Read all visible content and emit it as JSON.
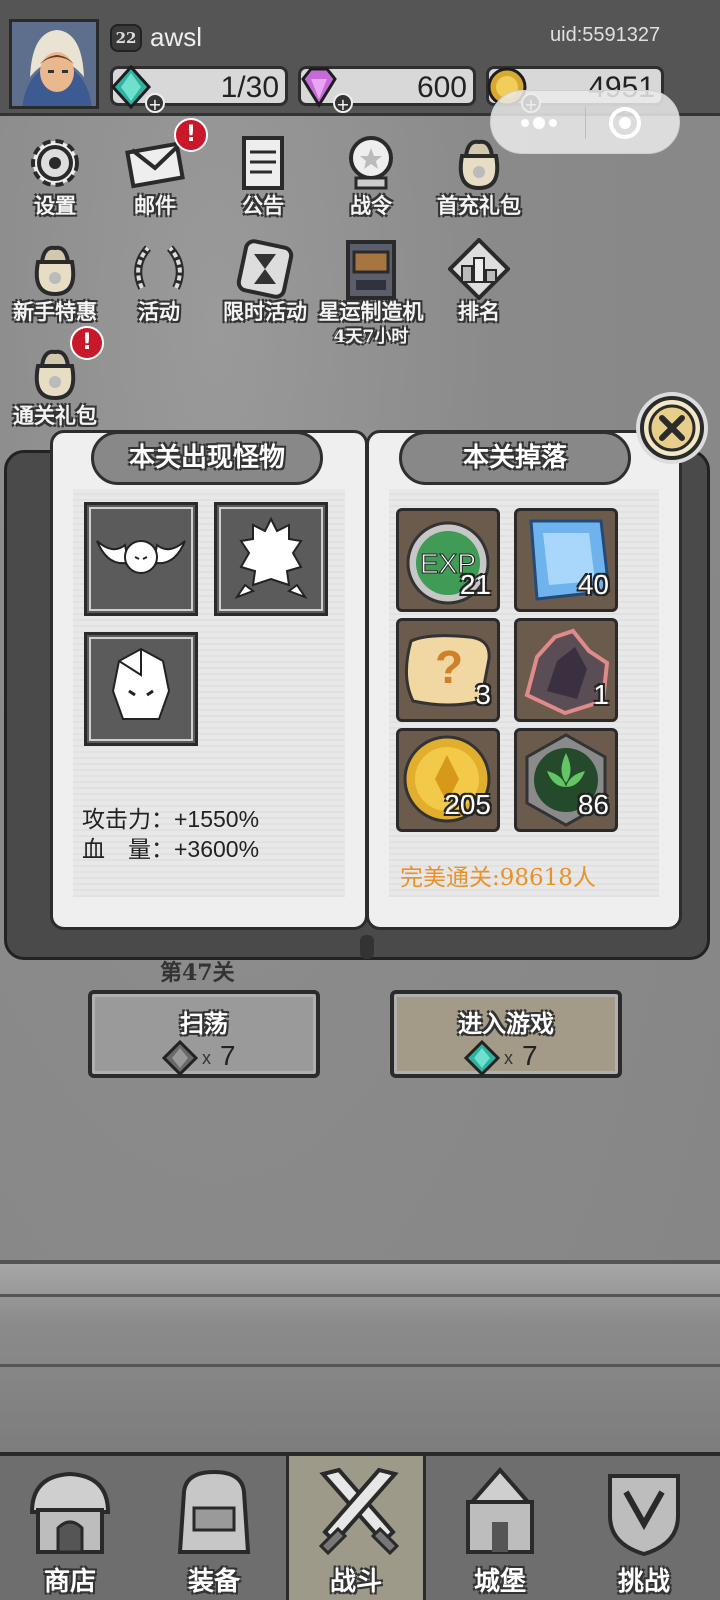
{
  "header": {
    "level": "22",
    "username": "awsl",
    "uid": "uid:5591327",
    "resources": [
      {
        "name": "energy",
        "icon": "teal-crystal-icon",
        "value": "1/30",
        "color": "#2fb3a0"
      },
      {
        "name": "gems",
        "icon": "purple-gem-icon",
        "value": "600",
        "color": "#c56bd8"
      },
      {
        "name": "gold",
        "icon": "gold-coin-icon",
        "value": "4951",
        "color": "#d7a832"
      }
    ]
  },
  "menu": [
    {
      "label": "设置",
      "icon": "gear-icon"
    },
    {
      "label": "邮件",
      "icon": "mail-icon",
      "alert": "!"
    },
    {
      "label": "公告",
      "icon": "scroll-icon"
    },
    {
      "label": "战令",
      "icon": "crystal-ball-icon"
    },
    {
      "label": "首充礼包",
      "icon": "gift-bag-icon"
    },
    {
      "label": "新手特惠",
      "icon": "gift-bag-icon"
    },
    {
      "label": "活动",
      "icon": "laurel-wreath-icon"
    },
    {
      "label": "限时活动",
      "icon": "hourglass-icon"
    },
    {
      "label": "星运制造机",
      "icon": "machine-icon",
      "sub": "4天7小时"
    },
    {
      "label": "排名",
      "icon": "podium-icon"
    },
    {
      "label": "通关礼包",
      "icon": "gift-bag-icon",
      "alert": "!"
    }
  ],
  "book": {
    "left_title": "本关出现怪物",
    "right_title": "本关掉落",
    "monsters": [
      "bat-monster-icon",
      "furball-monster-icon",
      "rock-golem-monster-icon"
    ],
    "attack": "攻击力：+1550%",
    "hp": "血　量：+3600%",
    "drops": [
      {
        "icon": "exp-orb-icon",
        "count": "21"
      },
      {
        "icon": "blue-crystal-icon",
        "count": "40"
      },
      {
        "icon": "mystery-scroll-icon",
        "count": "3"
      },
      {
        "icon": "dark-ore-icon",
        "count": "1"
      },
      {
        "icon": "gold-coin-icon",
        "count": "205"
      },
      {
        "icon": "green-rune-icon",
        "count": "86"
      }
    ],
    "perfect_clear": "完美通关:98618人"
  },
  "stage": {
    "name": "第47关",
    "sweep_label": "扫荡",
    "sweep_cost": "7",
    "enter_label": "进入游戏",
    "enter_cost": "7",
    "cost_x": "x"
  },
  "nav": [
    {
      "label": "商店",
      "icon": "shop-icon"
    },
    {
      "label": "装备",
      "icon": "backpack-icon"
    },
    {
      "label": "战斗",
      "icon": "crossed-swords-icon",
      "active": true
    },
    {
      "label": "城堡",
      "icon": "castle-icon"
    },
    {
      "label": "挑战",
      "icon": "crest-icon"
    }
  ],
  "colors": {
    "accent_orange": "#e8922b",
    "alert_red": "#c8182a"
  }
}
